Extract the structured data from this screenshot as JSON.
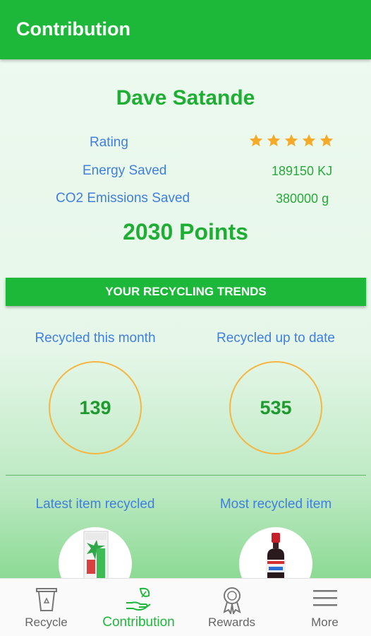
{
  "header": {
    "title": "Contribution"
  },
  "profile": {
    "name": "Dave Satande",
    "rating_label": "Rating",
    "rating_stars": 5,
    "energy_label": "Energy Saved",
    "energy_value": "189150 KJ",
    "co2_label": "CO2 Emissions Saved",
    "co2_value": "380000 g",
    "points": "2030 Points"
  },
  "trends": {
    "banner": "YOUR RECYCLING TRENDS",
    "month_label": "Recycled this month",
    "month_value": "139",
    "total_label": "Recycled up to date",
    "total_value": "535",
    "latest_label": "Latest item recycled",
    "most_label": "Most recycled item"
  },
  "nav": {
    "recycle": "Recycle",
    "contribution": "Contribution",
    "rewards": "Rewards",
    "more": "More"
  },
  "colors": {
    "primary": "#1db83a",
    "label_blue": "#3f7fe0",
    "star": "#f7a928",
    "circle_border": "#f5b642"
  }
}
